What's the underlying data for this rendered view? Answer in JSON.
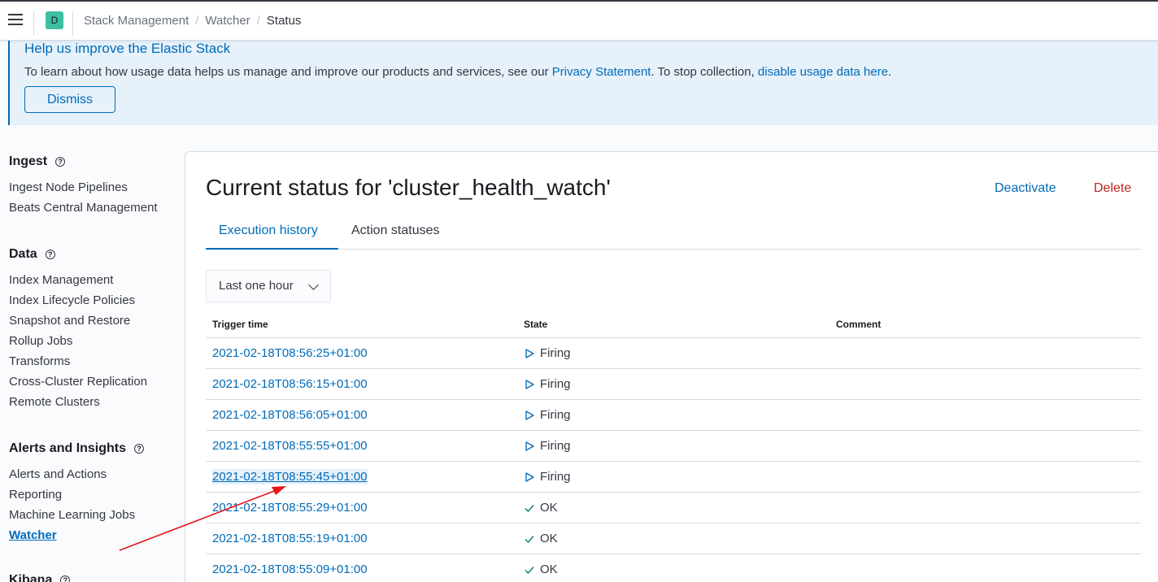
{
  "header": {
    "space_initial": "D",
    "breadcrumbs": [
      "Stack Management",
      "Watcher",
      "Status"
    ]
  },
  "callout": {
    "title": "Help us improve the Elastic Stack",
    "text_before": "To learn about how usage data helps us manage and improve our products and services, see our ",
    "privacy_link": "Privacy Statement",
    "text_middle": ". To stop collection, ",
    "disable_link": "disable usage data here",
    "text_after": ".",
    "dismiss_label": "Dismiss"
  },
  "sidebar": {
    "groups": [
      {
        "title": "Ingest",
        "items": [
          "Ingest Node Pipelines",
          "Beats Central Management"
        ]
      },
      {
        "title": "Data",
        "items": [
          "Index Management",
          "Index Lifecycle Policies",
          "Snapshot and Restore",
          "Rollup Jobs",
          "Transforms",
          "Cross-Cluster Replication",
          "Remote Clusters"
        ]
      },
      {
        "title": "Alerts and Insights",
        "items": [
          "Alerts and Actions",
          "Reporting",
          "Machine Learning Jobs",
          "Watcher"
        ]
      },
      {
        "title": "Kibana",
        "items": []
      }
    ],
    "active_item": "Watcher"
  },
  "main": {
    "title": "Current status for 'cluster_health_watch'",
    "deactivate_label": "Deactivate",
    "delete_label": "Delete",
    "tabs": [
      "Execution history",
      "Action statuses"
    ],
    "selected_tab": "Execution history",
    "time_range": "Last one hour",
    "columns": [
      "Trigger time",
      "State",
      "Comment"
    ],
    "rows": [
      {
        "time": "2021-02-18T08:56:25+01:00",
        "state": "Firing",
        "icon": "play-icon",
        "comment": ""
      },
      {
        "time": "2021-02-18T08:56:15+01:00",
        "state": "Firing",
        "icon": "play-icon",
        "comment": ""
      },
      {
        "time": "2021-02-18T08:56:05+01:00",
        "state": "Firing",
        "icon": "play-icon",
        "comment": ""
      },
      {
        "time": "2021-02-18T08:55:55+01:00",
        "state": "Firing",
        "icon": "play-icon",
        "comment": ""
      },
      {
        "time": "2021-02-18T08:55:45+01:00",
        "state": "Firing",
        "icon": "play-icon",
        "comment": ""
      },
      {
        "time": "2021-02-18T08:55:29+01:00",
        "state": "OK",
        "icon": "check-icon",
        "comment": ""
      },
      {
        "time": "2021-02-18T08:55:19+01:00",
        "state": "OK",
        "icon": "check-icon",
        "comment": ""
      },
      {
        "time": "2021-02-18T08:55:09+01:00",
        "state": "OK",
        "icon": "check-icon",
        "comment": ""
      }
    ],
    "focused_row": 4
  },
  "colors": {
    "link": "#006bb8",
    "danger": "#bd271e",
    "callout_bg": "#e6f1fa",
    "annotation_arrow": "#e8151b"
  }
}
